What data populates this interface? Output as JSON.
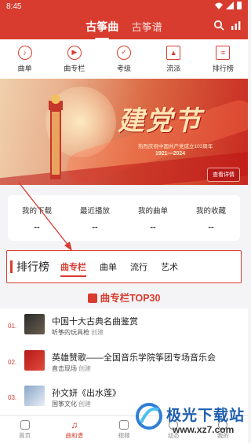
{
  "status": {
    "time": "8:45"
  },
  "header": {
    "tabs": [
      {
        "label": "古筝曲",
        "active": true
      },
      {
        "label": "古筝谱",
        "active": false
      }
    ],
    "accent": "#d83c2f"
  },
  "categories": [
    {
      "label": "曲单",
      "icon": "music-note-icon"
    },
    {
      "label": "曲专栏",
      "icon": "play-disc-icon"
    },
    {
      "label": "考级",
      "icon": "award-icon"
    },
    {
      "label": "流派",
      "icon": "graduation-cap-icon"
    },
    {
      "label": "排行榜",
      "icon": "ranking-icon"
    }
  ],
  "banner": {
    "title": "建党节",
    "subtitle": "热烈庆祝中国共产党成立103周年",
    "years": "1921—2024",
    "button": "查看详情"
  },
  "stats": [
    {
      "label": "我的下载",
      "value": "--"
    },
    {
      "label": "最近播放",
      "value": "--"
    },
    {
      "label": "我的曲单",
      "value": "--"
    },
    {
      "label": "我的收藏",
      "value": "--"
    }
  ],
  "ranking": {
    "title": "排行榜",
    "tabs": [
      "曲专栏",
      "曲单",
      "流行",
      "艺术"
    ]
  },
  "section_title": "曲专栏TOP30",
  "list": [
    {
      "num": "01.",
      "title": "中国十大古典名曲鉴赏",
      "author": "听筝的玩具枪",
      "role": "创建"
    },
    {
      "num": "02.",
      "title": "英雄赞歌——全国音乐学院筝团专场音乐会",
      "author": "直击现场",
      "role": "创建"
    },
    {
      "num": "03.",
      "title": "孙文妍《出水莲》",
      "author": "国筝文化",
      "role": "创建"
    }
  ],
  "nav": [
    {
      "label": "首页",
      "active": false
    },
    {
      "label": "曲和谱",
      "active": true
    },
    {
      "label": "视频",
      "active": false
    },
    {
      "label": "动态",
      "active": false
    },
    {
      "label": "我的",
      "active": false
    }
  ],
  "watermark": {
    "name": "极光下载站",
    "url": "www.xz7.com"
  }
}
